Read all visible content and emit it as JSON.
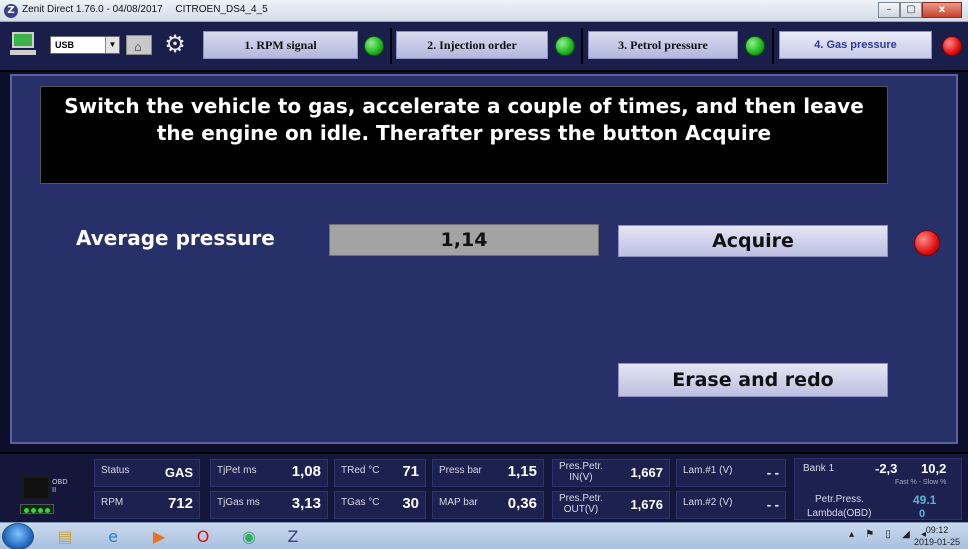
{
  "window": {
    "app_title": "Zenit Direct 1.76.0 - 04/08/2017",
    "vehicle": "CITROEN_DS4_4_5",
    "minimize": "–",
    "maximize": "▢",
    "close": "x"
  },
  "toolbar": {
    "connection_value": "USB",
    "steps": [
      {
        "label": "1. RPM signal",
        "status": "green"
      },
      {
        "label": "2. Injection order",
        "status": "green"
      },
      {
        "label": "3. Petrol pressure",
        "status": "green"
      },
      {
        "label": "4. Gas pressure",
        "status": "red"
      }
    ],
    "colors": {
      "active_step_text": "#2a3a9e",
      "ok": "#1cb21c",
      "error": "#e01010"
    }
  },
  "main": {
    "instruction": "Switch the vehicle to gas, accelerate a couple of times, and then leave the engine on idle. Therafter press the button Acquire",
    "average_pressure_label": "Average pressure",
    "average_pressure_value": "1,14",
    "acquire_label": "Acquire",
    "erase_label": "Erase and redo",
    "status": "red"
  },
  "statusbar": {
    "obd_label": "OBD II",
    "status_label": "Status",
    "status_value": "GAS",
    "rpm_label": "RPM",
    "rpm_value": "712",
    "tjpet_label": "TjPet ms",
    "tjpet_value": "1,08",
    "tjgas_label": "TjGas ms",
    "tjgas_value": "3,13",
    "tred_label": "TRed °C",
    "tred_value": "71",
    "tgas_label": "TGas °C",
    "tgas_value": "30",
    "press_label": "Press bar",
    "press_value": "1,15",
    "map_label": "MAP bar",
    "map_value": "0,36",
    "prespetr_in_label_1": "Pres.Petr.",
    "prespetr_in_label_2": "IN(V)",
    "prespetr_in_value": "1,667",
    "prespetr_out_label_1": "Pres.Petr.",
    "prespetr_out_label_2": "OUT(V)",
    "prespetr_out_value": "1,676",
    "lam1_label": "Lam.#1 (V)",
    "lam1_value": "- -",
    "lam2_label": "Lam.#2 (V)",
    "lam2_value": "- -",
    "bank_label": "Bank 1",
    "bank_fast": "-2,3",
    "bank_slow": "10,2",
    "bank_sub": "Fast % - Slow %",
    "petr_press_label": "Petr.Press.",
    "petr_press_value": "49.1",
    "lambda_obd_label": "Lambda(OBD)",
    "lambda_obd_value": "0"
  },
  "taskbar": {
    "icons": [
      "windows-start",
      "file-explorer",
      "internet-explorer",
      "media-player",
      "opera",
      "chrome",
      "zenit"
    ],
    "time": "09:12",
    "date": "2019-01-25"
  }
}
